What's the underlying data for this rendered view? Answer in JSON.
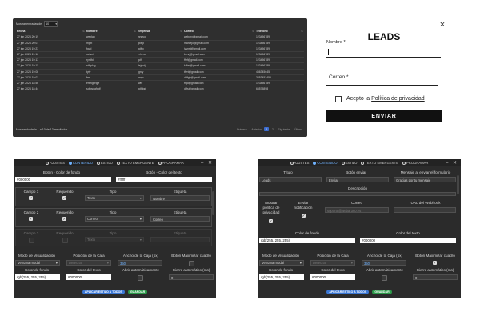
{
  "table_panel": {
    "show_label": "Mostrar entradas de",
    "show_value": "10",
    "columns": [
      "Fecha",
      "Nombre",
      "Empresa",
      "Correo",
      "Teléfono"
    ],
    "rows": [
      [
        "27 jun 2024 20:19",
        "weblan",
        "innovo",
        "weborx@gmail.com",
        "123456789"
      ],
      [
        "27 jun 2024 20:01",
        "mjeit",
        "jpdsp",
        "marcejo@gmail.com",
        "123456789"
      ],
      [
        "27 jun 2024 19:23",
        "fgvd",
        "gdffg",
        "ivvnst@gmail.com",
        "123456789"
      ],
      [
        "27 jun 2024 19:16",
        "seheri",
        "erheru",
        "kenrj@gmail.com",
        "123456789"
      ],
      [
        "27 jun 2024 19:13",
        "ryrdfd",
        "gdf",
        "fffrf@gmail.com",
        "123456789"
      ],
      [
        "27 jun 2024 19:11",
        "rdfgdug",
        "dsjyotj",
        "kdhrt@gmail.com",
        "123456789"
      ],
      [
        "27 jun 2024 19:08",
        "tyty",
        "tgnty",
        "tfyrt@gmail.com",
        "456345645"
      ],
      [
        "27 jun 2024 19:02",
        "fret",
        "fmrjn",
        "ddfgh@gmail.com",
        "3453453455"
      ],
      [
        "27 jun 2024 18:56",
        "ererigerige",
        "fwfe",
        "ffgd@gmail.com",
        "123456789"
      ],
      [
        "27 jun 2024 18:44",
        "sdfgsdafgdf",
        "gdfdgd",
        "drfs@gmail.com",
        "65575898"
      ]
    ],
    "footer_text": "Mostrando de la 1 a 10 de 13 resultados",
    "pager": [
      "Primero",
      "Anterior",
      "1",
      "2",
      "Siguiente",
      "Último"
    ]
  },
  "lead_form": {
    "title": "LEADS",
    "nombre_label": "Nombre *",
    "correo_label": "Correo *",
    "privacy_prefix": "Acepto la ",
    "privacy_link": "Política de privacidad",
    "submit_label": "ENVIAR",
    "close_icon": "×"
  },
  "editor_tabs": [
    "AJUSTES",
    "CONTENIDO",
    "ESTILO",
    "TEXTO EMERGENTE",
    "PROGRAMAR"
  ],
  "editor_window_buttons": "– ✕",
  "editor_a": {
    "btn_bg_label": "Botón - Color de fondo",
    "btn_bg_value": "#000000",
    "btn_text_label": "Botón - Color del texto",
    "btn_text_value": "#ffffff",
    "fields": [
      {
        "name": "Campo 1",
        "required_label": "Requerido",
        "tipo_label": "Tipo",
        "tipo_value": "Texto",
        "etiqueta_label": "Etiqueta",
        "etiqueta_value": "Nombre"
      },
      {
        "name": "Campo 2",
        "required_label": "Requerido",
        "tipo_label": "Tipo",
        "tipo_value": "Correo",
        "etiqueta_label": "Etiqueta",
        "etiqueta_value": "Correo"
      },
      {
        "name": "Campo 3",
        "required_label": "Requerido",
        "tipo_label": "Tipo",
        "tipo_value": "Texto",
        "etiqueta_label": "Etiqueta",
        "etiqueta_value": ""
      }
    ],
    "modo_label": "Modo de Visualización",
    "modo_value": "Ventana modal",
    "posicion_label": "Posición de la Caja",
    "posicion_value": "Derecha",
    "ancho_label": "Ancho de la Caja (px)",
    "ancho_value": "350",
    "maximizar_label": "Botón Maximizar cuadro",
    "bg_label": "Color de fondo",
    "bg_value": "rgb(255, 255, 255)",
    "text_color_label": "Color del texto",
    "text_color_value": "#000000",
    "abrir_label": "Abrir automáticamente",
    "cierre_label": "Cierre automático (ms)",
    "cierre_value": "0",
    "apply_btn": "APLICAR ESTILO A TODOS",
    "save_btn": "GUARDAR"
  },
  "editor_b": {
    "titulo_label": "Título",
    "titulo_value": "Leads",
    "boton_label": "Botón enviar",
    "boton_value": "Enviar",
    "mensaje_label": "Mensaje al enviar el formulario",
    "mensaje_value": "Gracias por tu mensaje",
    "descripcion_label": "Descripción",
    "mostrar_label": "Mostrar política de privacidad",
    "enviar_notif_label": "Enviar notificación",
    "correo_label": "Correo",
    "correo_placeholder": "soporte@webar360.es",
    "webhook_label": "URL del Webhook",
    "bg_label": "Color de fondo",
    "bg_value": "rgb(255, 255, 255)",
    "text_label": "Color del texto",
    "text_value": "#000000",
    "modo_label": "Modo de Visualización",
    "modo_value": "Ventana modal",
    "posicion_label": "Posición de la Caja",
    "posicion_value": "Derecha",
    "ancho_label": "Ancho de la Caja (px)",
    "ancho_value": "350",
    "maximizar_label": "Botón Maximizar cuadro",
    "bg2_label": "Color de fondo",
    "bg2_value": "rgb(255, 255, 255)",
    "text2_label": "Color del texto",
    "text2_value": "#000000",
    "abrir_label": "Abrir automáticamente",
    "cierre_label": "Cierre automático (ms)",
    "cierre_value": "0",
    "apply_btn": "APLICAR ESTILO A TODOS",
    "save_btn": "GUARDAR"
  },
  "colors": {
    "panel_dark": "#2b2b2b",
    "accent_blue": "#3b77d4",
    "save_green": "#2c9b4a",
    "active_tab": "#6fb2ff"
  }
}
